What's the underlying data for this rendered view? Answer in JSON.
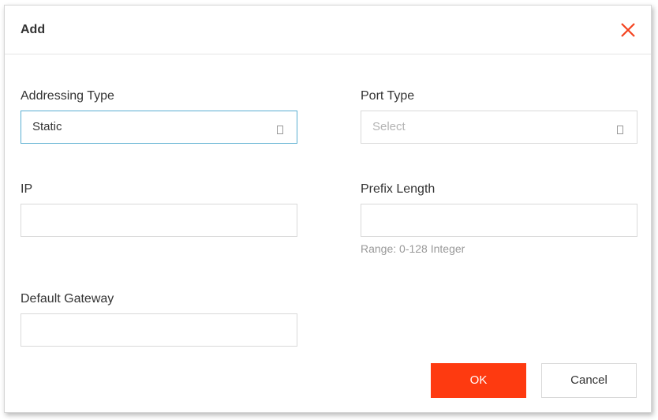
{
  "dialog": {
    "title": "Add",
    "close_icon": "close-icon"
  },
  "fields": {
    "addressing_type": {
      "label": "Addressing Type",
      "value": "Static"
    },
    "port_type": {
      "label": "Port Type",
      "placeholder": "Select"
    },
    "ip": {
      "label": "IP",
      "value": ""
    },
    "prefix_length": {
      "label": "Prefix Length",
      "value": "",
      "hint": "Range: 0-128 Integer"
    },
    "default_gateway": {
      "label": "Default Gateway",
      "value": ""
    }
  },
  "buttons": {
    "ok_label": "OK",
    "cancel_label": "Cancel"
  },
  "colors": {
    "accent": "#fe3a10",
    "focus_border": "#5aaed1"
  }
}
